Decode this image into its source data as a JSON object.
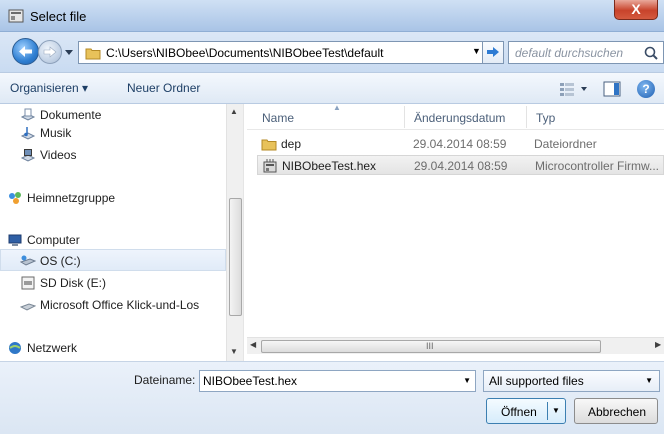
{
  "window": {
    "title": "Select file",
    "close_glyph": "X"
  },
  "address": {
    "path": "C:\\Users\\NIBObee\\Documents\\NIBObeeTest\\default",
    "search_placeholder": "default durchsuchen"
  },
  "toolbar": {
    "organize": "Organisieren ▾",
    "new_folder": "Neuer Ordner",
    "help": "?"
  },
  "nav_pane": {
    "items": [
      {
        "label": "Dokumente",
        "icon": "documents-icon"
      },
      {
        "label": "Musik",
        "icon": "music-icon"
      },
      {
        "label": "Videos",
        "icon": "videos-icon"
      },
      {
        "label": "Heimnetzgruppe",
        "icon": "homegroup-icon"
      },
      {
        "label": "Computer",
        "icon": "computer-icon"
      },
      {
        "label": "OS (C:)",
        "icon": "drive-icon"
      },
      {
        "label": "SD Disk (E:)",
        "icon": "sd-card-icon"
      },
      {
        "label": "Microsoft Office Klick-und-Los",
        "icon": "virtual-drive-icon"
      },
      {
        "label": "Netzwerk",
        "icon": "network-icon"
      }
    ],
    "selected": "OS (C:)"
  },
  "file_list": {
    "columns": [
      "Name",
      "Änderungsdatum",
      "Typ"
    ],
    "rows": [
      {
        "name": "dep",
        "date": "29.04.2014 08:59",
        "type": "Dateiordner",
        "icon": "folder-icon"
      },
      {
        "name": "NIBObeeTest.hex",
        "date": "29.04.2014 08:59",
        "type": "Microcontroller Firmw...",
        "icon": "firmware-file-icon"
      }
    ],
    "selected": "NIBObeeTest.hex",
    "hscroll_grip": "III"
  },
  "bottom": {
    "filename_label": "Dateiname:",
    "filename_value": "NIBObeeTest.hex",
    "filter_value": "All supported files",
    "open_label": "Öffnen",
    "cancel_label": "Abbrechen"
  },
  "colors": {
    "accent": "#2f7fd2",
    "close": "#c8432b",
    "selection": "#e1ebf8"
  }
}
